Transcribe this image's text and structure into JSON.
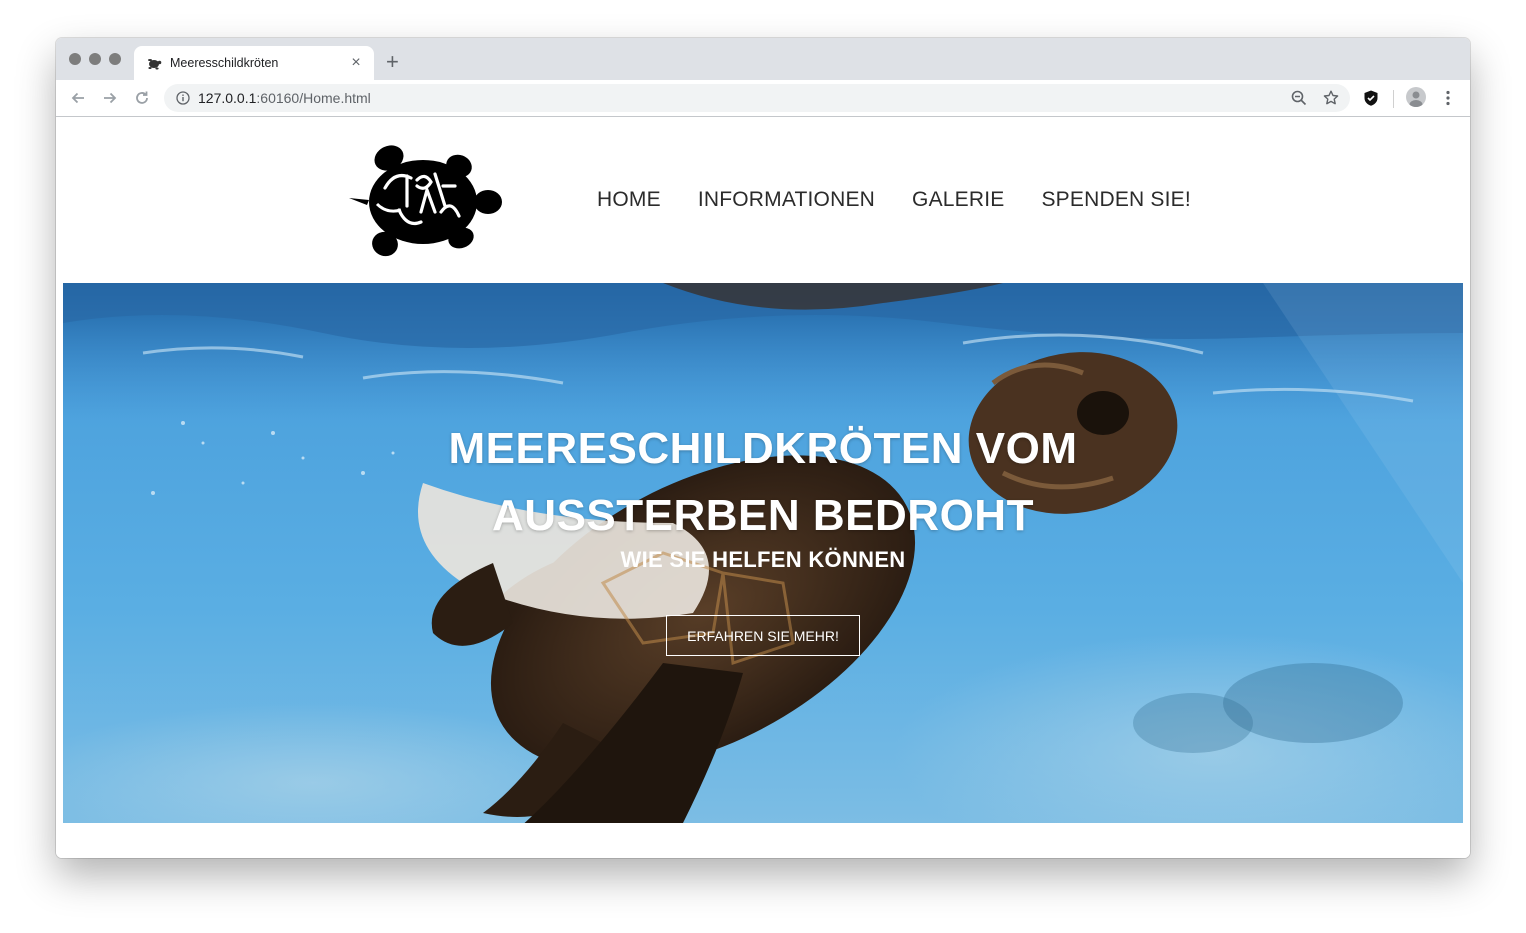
{
  "browser": {
    "tab_title": "Meeresschildkröten",
    "tab_close": "×",
    "new_tab": "+",
    "url_host": "127.0.0.1",
    "url_path": ":60160/Home.html"
  },
  "site": {
    "nav": [
      "HOME",
      "INFORMATIONEN",
      "GALERIE",
      "SPENDEN SIE!"
    ],
    "hero": {
      "title_line1": "MEERESCHILDKRÖTEN VOM",
      "title_line2": "AUSSTERBEN BEDROHT",
      "subtitle": "WIE SIE HELFEN KÖNNEN",
      "button": "ERFAHREN SIE MEHR!"
    }
  },
  "colors": {
    "ocean_light": "#5aa9e0",
    "ocean_dark": "#1f6fb0",
    "turtle_shell": "#3b2a1c"
  },
  "icons": [
    "turtle-favicon-icon",
    "back-arrow-icon",
    "forward-arrow-icon",
    "reload-icon",
    "info-icon",
    "zoom-icon",
    "star-icon",
    "shield-extension-icon",
    "profile-avatar-icon",
    "menu-dots-icon",
    "turtle-logo-icon"
  ]
}
